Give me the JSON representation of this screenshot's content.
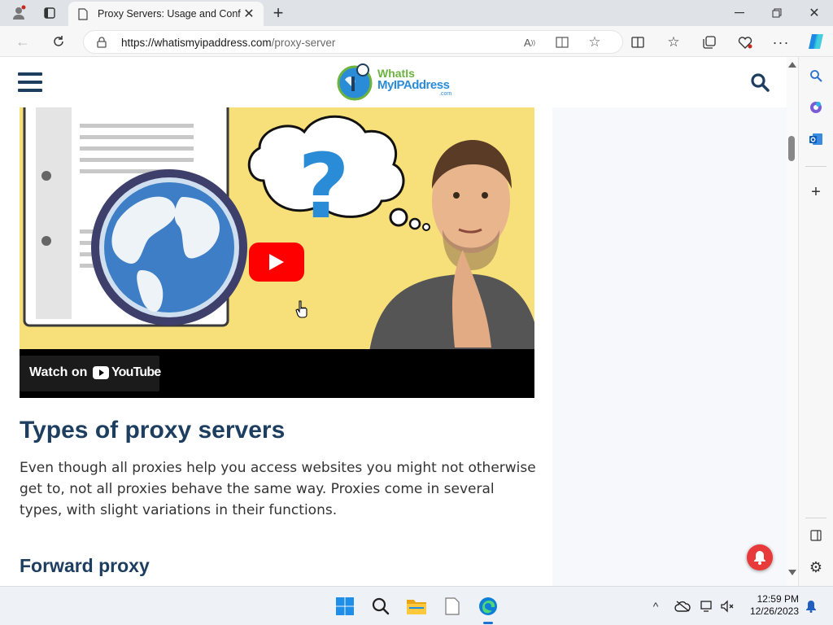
{
  "browser": {
    "tab_title": "Proxy Servers: Usage and Config",
    "url_host": "https://whatismyipaddress.com",
    "url_path": "/proxy-server"
  },
  "site": {
    "logo_line1": "WhatIs",
    "logo_line2": "MyIPAddress",
    "logo_suffix": ".com"
  },
  "video": {
    "watch_label": "Watch on",
    "youtube_label": "YouTube"
  },
  "article": {
    "heading": "Types of proxy servers",
    "paragraph": "Even though all proxies help you access websites you might not otherwise get to, not all proxies behave the same way. Proxies come in several types, with slight variations in their functions.",
    "subheading": "Forward proxy"
  },
  "taskbar": {
    "time": "12:59 PM",
    "date": "12/26/2023"
  },
  "colors": {
    "heading": "#1e3e60",
    "video_bg": "#f7df7a",
    "youtube_red": "#ff0000",
    "notification_red": "#e83a3a"
  }
}
